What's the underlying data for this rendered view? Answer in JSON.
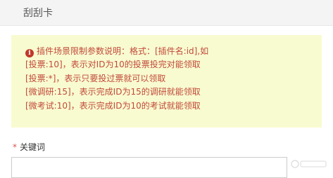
{
  "header": {
    "title": "刮刮卡"
  },
  "notice": {
    "icon": "info-icon",
    "lines": [
      "插件场景限制参数说明：格式：[插件名:id],如",
      "[投票:10]，表示对ID为10的投票投完对能领取",
      "[投票:*]，表示只要投过票就可以领取",
      "[微调研:15]，表示完成ID为15的调研就能领取",
      "[微考试:10]，表示完成ID为10的考试就能领取"
    ],
    "text_color": "#c24a3b",
    "background": "#f8fbd0"
  },
  "keyword_field": {
    "required_mark": "*",
    "label": "关键词",
    "value": ""
  }
}
